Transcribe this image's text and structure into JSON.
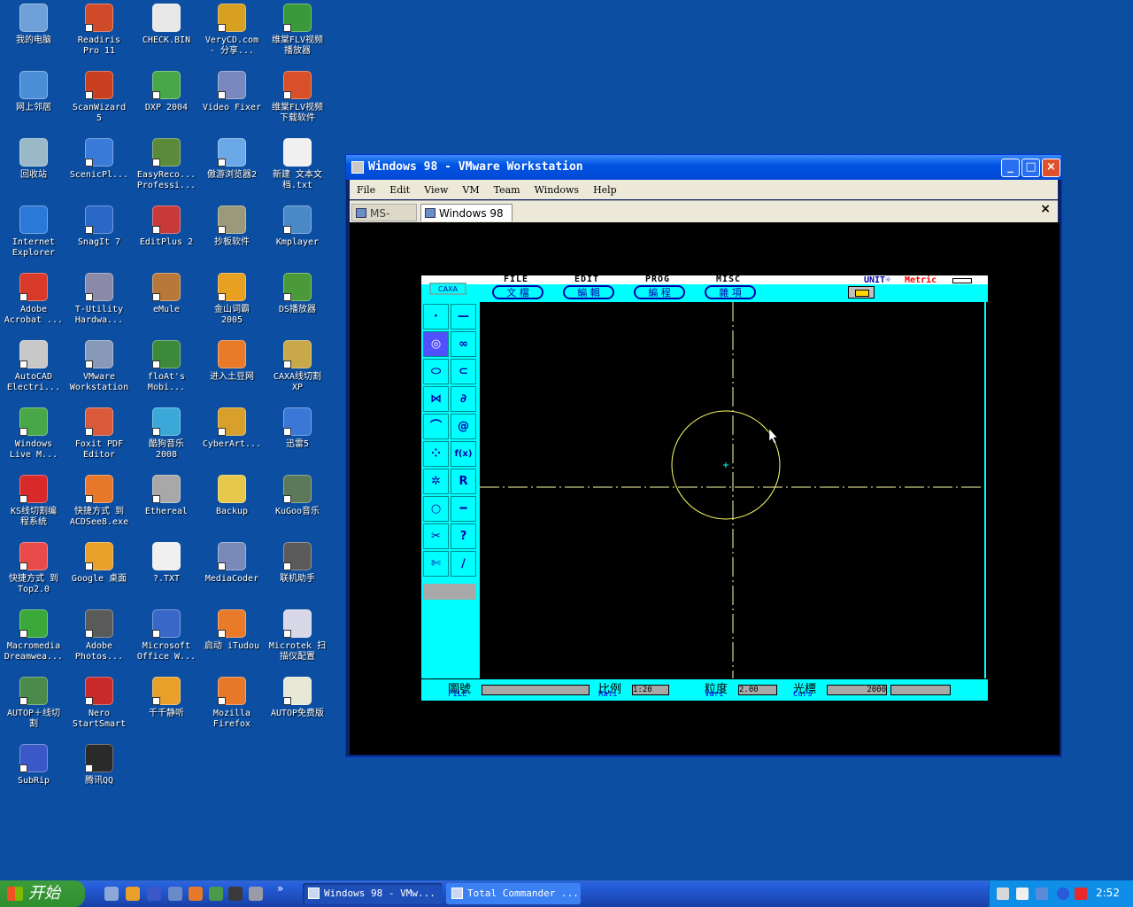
{
  "desktop": {
    "icons": [
      {
        "label": "我的电脑",
        "color": "#6fa0d8",
        "arrow": false
      },
      {
        "label": "Readiris\nPro 11",
        "color": "#d04a2a",
        "arrow": true
      },
      {
        "label": "CHECK.BIN",
        "color": "#e8e8e8",
        "arrow": false
      },
      {
        "label": "VeryCD.com\n- 分享...",
        "color": "#d8a020",
        "arrow": true
      },
      {
        "label": "维棠FLV视频\n播放器",
        "color": "#3a9a3a",
        "arrow": true
      },
      {
        "label": "网上邻居",
        "color": "#4b8ed8",
        "arrow": false
      },
      {
        "label": "ScanWizard\n5",
        "color": "#c84020",
        "arrow": true
      },
      {
        "label": "DXP 2004",
        "color": "#48a848",
        "arrow": true
      },
      {
        "label": "Video Fixer",
        "color": "#7a88c0",
        "arrow": true
      },
      {
        "label": "维棠FLV视频\n下载软件",
        "color": "#d8502a",
        "arrow": true
      },
      {
        "label": "回收站",
        "color": "#9ab8c8",
        "arrow": false
      },
      {
        "label": "ScenicPl...",
        "color": "#3a7ad8",
        "arrow": true
      },
      {
        "label": "EasyReco...\nProfessi...",
        "color": "#5a8a3a",
        "arrow": true
      },
      {
        "label": "傲游浏览器2",
        "color": "#6aa8e8",
        "arrow": true
      },
      {
        "label": "新建 文本文\n档.txt",
        "color": "#f0f0f0",
        "arrow": false
      },
      {
        "label": "Internet\nExplorer",
        "color": "#2a78d8",
        "arrow": false
      },
      {
        "label": "SnagIt 7",
        "color": "#2a68c8",
        "arrow": true
      },
      {
        "label": "EditPlus 2",
        "color": "#c83a3a",
        "arrow": true
      },
      {
        "label": "抄板软件",
        "color": "#9a9a7a",
        "arrow": true
      },
      {
        "label": "Kmplayer",
        "color": "#4a88c8",
        "arrow": true
      },
      {
        "label": "Adobe\nAcrobat ...",
        "color": "#d83a2a",
        "arrow": true
      },
      {
        "label": "T-Utility\nHardwa...",
        "color": "#8a8aa8",
        "arrow": true
      },
      {
        "label": "eMule",
        "color": "#b8783a",
        "arrow": true
      },
      {
        "label": "金山词霸\n2005",
        "color": "#e8a020",
        "arrow": true
      },
      {
        "label": "DS播放器",
        "color": "#4a9a3a",
        "arrow": true
      },
      {
        "label": "AutoCAD\nElectri...",
        "color": "#c8c8c8",
        "arrow": true
      },
      {
        "label": "VMware\nWorkstation",
        "color": "#8898b8",
        "arrow": true
      },
      {
        "label": "floAt's\nMobi...",
        "color": "#3a8a3a",
        "arrow": true
      },
      {
        "label": "进入土豆网",
        "color": "#e87a2a",
        "arrow": false
      },
      {
        "label": "CAXA线切割\nXP",
        "color": "#c8a848",
        "arrow": true
      },
      {
        "label": "Windows\nLive M...",
        "color": "#48a848",
        "arrow": true
      },
      {
        "label": "Foxit PDF\nEditor",
        "color": "#d85a3a",
        "arrow": true
      },
      {
        "label": "酷狗音乐\n2008",
        "color": "#3aa8d8",
        "arrow": true
      },
      {
        "label": "CyberArt...",
        "color": "#d8a02a",
        "arrow": true
      },
      {
        "label": "迅雷5",
        "color": "#3a78d8",
        "arrow": true
      },
      {
        "label": "KS线切割编\n程系统",
        "color": "#d82a2a",
        "arrow": true
      },
      {
        "label": "快捷方式 到\nACDSee8.exe",
        "color": "#e8782a",
        "arrow": true
      },
      {
        "label": "Ethereal",
        "color": "#a8a8a8",
        "arrow": true
      },
      {
        "label": "Backup",
        "color": "#e8c84a",
        "arrow": false
      },
      {
        "label": "KuGoo音乐",
        "color": "#5a7a5a",
        "arrow": true
      },
      {
        "label": "快捷方式 到\nTop2.0",
        "color": "#e84a4a",
        "arrow": true
      },
      {
        "label": "Google 桌面",
        "color": "#e8a02a",
        "arrow": true
      },
      {
        "label": "?.TXT",
        "color": "#f0f0f0",
        "arrow": false
      },
      {
        "label": "MediaCoder",
        "color": "#7a8ab8",
        "arrow": true
      },
      {
        "label": "联机助手",
        "color": "#5a5a5a",
        "arrow": true
      },
      {
        "label": "Macromedia\nDreamwea...",
        "color": "#3aa83a",
        "arrow": true
      },
      {
        "label": "Adobe\nPhotos...",
        "color": "#5a5a5a",
        "arrow": true
      },
      {
        "label": "Microsoft\nOffice W...",
        "color": "#3a68c8",
        "arrow": true
      },
      {
        "label": "启动 iTudou",
        "color": "#e87a2a",
        "arrow": true
      },
      {
        "label": "Microtek 扫\n描仪配置",
        "color": "#d8d8e8",
        "arrow": true
      },
      {
        "label": "AUTOP＋线切\n割",
        "color": "#4a8a4a",
        "arrow": true
      },
      {
        "label": "Nero\nStartSmart",
        "color": "#c82a2a",
        "arrow": true
      },
      {
        "label": "千千静听",
        "color": "#e8a02a",
        "arrow": true
      },
      {
        "label": "Mozilla\nFirefox",
        "color": "#e8782a",
        "arrow": true
      },
      {
        "label": "AUTOP免费版",
        "color": "#e8e8d8",
        "arrow": true
      },
      {
        "label": "SubRip",
        "color": "#3a58c8",
        "arrow": true
      },
      {
        "label": "腾讯QQ",
        "color": "#2a2a2a",
        "arrow": true
      }
    ]
  },
  "vmware": {
    "title": "Windows 98 - VMware Workstation",
    "menu": [
      "File",
      "Edit",
      "View",
      "VM",
      "Team",
      "Windows",
      "Help"
    ],
    "tabs": {
      "msdos": "MS-DOS",
      "win98": "Windows 98",
      "close": "×"
    },
    "controls": {
      "minimize": "_",
      "maximize": "□",
      "close": "×"
    }
  },
  "cad": {
    "logo": "CAXA",
    "menus": [
      {
        "en": "FILE",
        "cn": "文 檔"
      },
      {
        "en": "EDIT",
        "cn": "編 輯"
      },
      {
        "en": "PROG",
        "cn": "編 程"
      },
      {
        "en": "MISC",
        "cn": "雜 項"
      }
    ],
    "unit_label": "UNIT☼",
    "unit_value": "Metric",
    "status": {
      "file_cn": "圖號",
      "file_en": "FILE",
      "file_value": "",
      "ratio_cn": "比例",
      "ratio_en": "Rati",
      "ratio_value": "1:20",
      "vari_cn": "粒度",
      "vari_en": "Vari",
      "vari_value": "2.00",
      "curs_cn": "光標",
      "curs_en": "Curs",
      "curs_x": "2000",
      "curs_y": ""
    },
    "colors": {
      "panel": "#00ffff",
      "circle": "#ffff66",
      "axis": "#ffffaa",
      "accent": "#0000aa"
    }
  },
  "taskbar": {
    "start": "开始",
    "buttons": [
      {
        "label": "Windows 98 - VMw...",
        "active": true
      },
      {
        "label": "Total Commander ...",
        "active": false
      }
    ],
    "clock": "2:52",
    "overflow": "»"
  }
}
